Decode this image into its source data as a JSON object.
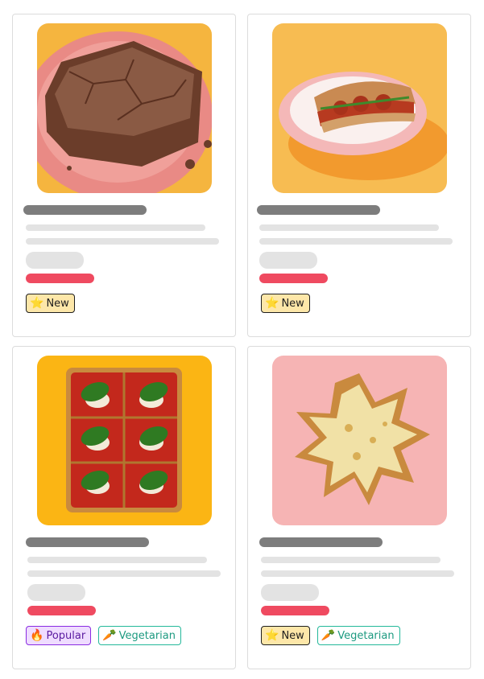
{
  "cards": [
    {
      "name": "card-brownie",
      "image_icon": "brownie-image",
      "image_bg": "#f5b53f",
      "badges": [
        {
          "kind": "new",
          "icon": "star-icon",
          "label": "New"
        }
      ]
    },
    {
      "name": "card-meatball-sub",
      "image_icon": "sandwich-image",
      "image_bg": "#f7bc52",
      "badges": [
        {
          "kind": "new",
          "icon": "star-icon",
          "label": "New"
        }
      ]
    },
    {
      "name": "card-margherita-square",
      "image_icon": "pizza-image",
      "image_bg": "#fbb514",
      "badges": [
        {
          "kind": "popular",
          "icon": "fire-icon",
          "label": "Popular"
        },
        {
          "kind": "veg",
          "icon": "carrot-icon",
          "label": "Vegetarian"
        }
      ]
    },
    {
      "name": "card-star-cheese-bread",
      "image_icon": "cheese-bread-image",
      "image_bg": "#f6b4b4",
      "badges": [
        {
          "kind": "new",
          "icon": "star-icon",
          "label": "New"
        },
        {
          "kind": "veg",
          "icon": "carrot-icon",
          "label": "Vegetarian"
        }
      ]
    }
  ],
  "colors": {
    "skeleton_title": "#7d7d7d",
    "skeleton_line": "#e3e3e3",
    "skeleton_price": "#ef4a60",
    "badge_new_bg": "#fde7a9",
    "badge_popular_bg": "#efdcff",
    "badge_veg_border": "#24b89a"
  }
}
